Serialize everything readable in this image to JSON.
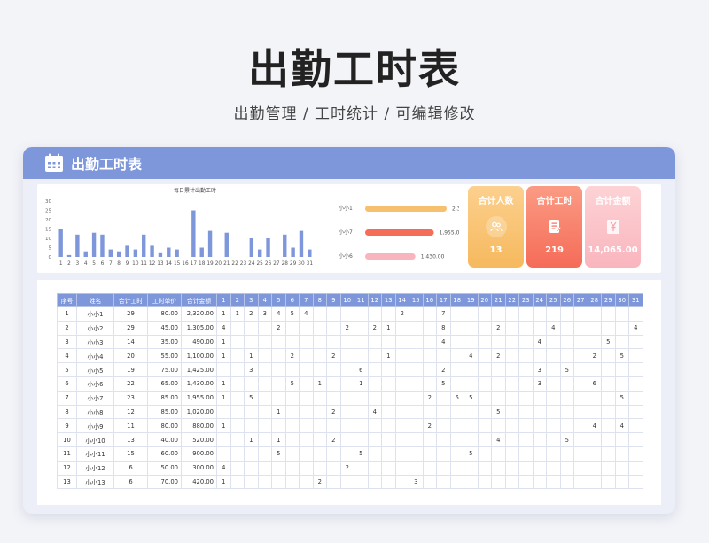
{
  "hero": {
    "title": "出勤工时表",
    "subtitle": "出勤管理 / 工时统计 /  可编辑修改"
  },
  "card": {
    "title": "出勤工时表"
  },
  "colors": {
    "accent": "#7e97db",
    "bar": "#7e97db",
    "hbar_1": "#f6c06f",
    "hbar_2": "#f56c58",
    "hbar_3": "#f9b5bd"
  },
  "chart_data": [
    {
      "type": "bar",
      "title": "每日累计出勤工时",
      "categories": [
        "1",
        "2",
        "3",
        "4",
        "5",
        "6",
        "7",
        "8",
        "9",
        "10",
        "11",
        "12",
        "13",
        "14",
        "15",
        "16",
        "17",
        "18",
        "19",
        "20",
        "21",
        "22",
        "23",
        "24",
        "25",
        "26",
        "27",
        "28",
        "29",
        "30",
        "31"
      ],
      "values": [
        15,
        1,
        12,
        3,
        13,
        12,
        4,
        3,
        6,
        4,
        12,
        6,
        2,
        5,
        4,
        0,
        25,
        5,
        14,
        0,
        13,
        0,
        0,
        10,
        4,
        10,
        0,
        12,
        5,
        14,
        4
      ],
      "yticks": [
        "30",
        "25",
        "20",
        "15",
        "10",
        "5",
        "0"
      ],
      "ylim": [
        0,
        30
      ]
    },
    {
      "type": "bar",
      "orientation": "horizontal",
      "categories": [
        "小小1",
        "小小7",
        "小小6"
      ],
      "values": [
        2320.0,
        1955.0,
        1430.0
      ],
      "labels": [
        "2,320.00",
        "1,955.00",
        "1,430.00"
      ]
    }
  ],
  "kpis": [
    {
      "title": "合计人数",
      "icon": "people-icon",
      "value": "13"
    },
    {
      "title": "合计工时",
      "icon": "document-icon",
      "value": "219"
    },
    {
      "title": "合计金额",
      "icon": "yen-icon",
      "value": "14,065.00"
    }
  ],
  "table": {
    "headers": [
      "序号",
      "姓名",
      "合计工时",
      "工时单价",
      "合计金额"
    ],
    "days": [
      "1",
      "2",
      "3",
      "4",
      "5",
      "6",
      "7",
      "8",
      "9",
      "10",
      "11",
      "12",
      "13",
      "14",
      "15",
      "16",
      "17",
      "18",
      "19",
      "20",
      "21",
      "22",
      "23",
      "24",
      "25",
      "26",
      "27",
      "28",
      "29",
      "30",
      "31"
    ],
    "rows": [
      {
        "no": "1",
        "name": "小小1",
        "hours": "29",
        "rate": "80.00",
        "amount": "2,320.00",
        "d": {
          "1": "1",
          "2": "1",
          "3": "2",
          "4": "3",
          "5": "4",
          "6": "5",
          "7": "4",
          "14": "2",
          "17": "7"
        }
      },
      {
        "no": "2",
        "name": "小小2",
        "hours": "29",
        "rate": "45.00",
        "amount": "1,305.00",
        "d": {
          "1": "4",
          "5": "2",
          "10": "2",
          "12": "2",
          "13": "1",
          "17": "8",
          "21": "2",
          "25": "4",
          "31": "4"
        }
      },
      {
        "no": "3",
        "name": "小小3",
        "hours": "14",
        "rate": "35.00",
        "amount": "490.00",
        "d": {
          "1": "1",
          "17": "4",
          "24": "4",
          "29": "5"
        }
      },
      {
        "no": "4",
        "name": "小小4",
        "hours": "20",
        "rate": "55.00",
        "amount": "1,100.00",
        "d": {
          "1": "1",
          "3": "1",
          "6": "2",
          "9": "2",
          "13": "1",
          "19": "4",
          "21": "2",
          "28": "2",
          "30": "5"
        }
      },
      {
        "no": "5",
        "name": "小小5",
        "hours": "19",
        "rate": "75.00",
        "amount": "1,425.00",
        "d": {
          "3": "3",
          "11": "6",
          "17": "2",
          "24": "3",
          "26": "5"
        }
      },
      {
        "no": "6",
        "name": "小小6",
        "hours": "22",
        "rate": "65.00",
        "amount": "1,430.00",
        "d": {
          "1": "1",
          "6": "5",
          "8": "1",
          "11": "1",
          "17": "5",
          "24": "3",
          "28": "6"
        }
      },
      {
        "no": "7",
        "name": "小小7",
        "hours": "23",
        "rate": "85.00",
        "amount": "1,955.00",
        "d": {
          "1": "1",
          "3": "5",
          "16": "2",
          "18": "5",
          "19": "5",
          "30": "5"
        }
      },
      {
        "no": "8",
        "name": "小小8",
        "hours": "12",
        "rate": "85.00",
        "amount": "1,020.00",
        "d": {
          "5": "1",
          "9": "2",
          "12": "4",
          "21": "5"
        }
      },
      {
        "no": "9",
        "name": "小小9",
        "hours": "11",
        "rate": "80.00",
        "amount": "880.00",
        "d": {
          "1": "1",
          "16": "2",
          "28": "4",
          "30": "4"
        }
      },
      {
        "no": "10",
        "name": "小小10",
        "hours": "13",
        "rate": "40.00",
        "amount": "520.00",
        "d": {
          "3": "1",
          "5": "1",
          "9": "2",
          "21": "4",
          "26": "5"
        }
      },
      {
        "no": "11",
        "name": "小小11",
        "hours": "15",
        "rate": "60.00",
        "amount": "900.00",
        "d": {
          "5": "5",
          "11": "5",
          "19": "5"
        }
      },
      {
        "no": "12",
        "name": "小小12",
        "hours": "6",
        "rate": "50.00",
        "amount": "300.00",
        "d": {
          "1": "4",
          "10": "2"
        }
      },
      {
        "no": "13",
        "name": "小小13",
        "hours": "6",
        "rate": "70.00",
        "amount": "420.00",
        "d": {
          "1": "1",
          "8": "2",
          "15": "3"
        }
      }
    ]
  }
}
